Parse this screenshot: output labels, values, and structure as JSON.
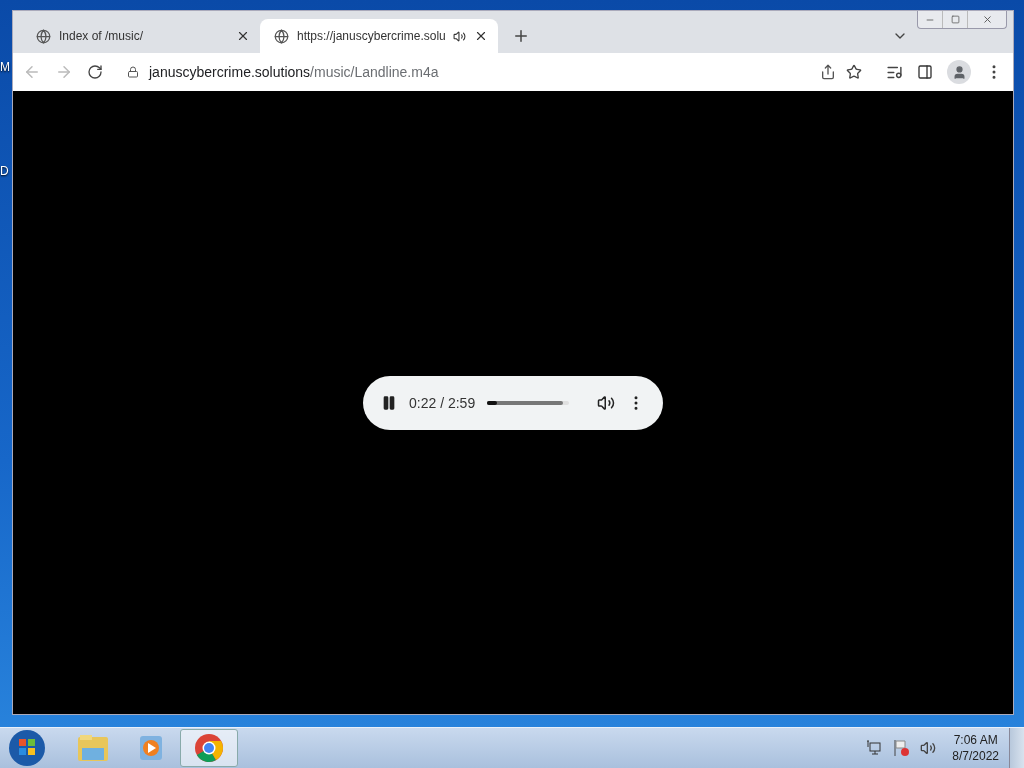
{
  "desktop": {
    "icon_labels": [
      "M",
      "D"
    ]
  },
  "browser": {
    "tabs": [
      {
        "title": "Index of /music/",
        "selected": false,
        "audio": false
      },
      {
        "title": "https://januscybercrime.solu",
        "selected": true,
        "audio": true
      }
    ],
    "address": {
      "host": "januscybercrime.solutions",
      "path": "/music/Landline.m4a"
    },
    "player": {
      "playing": true,
      "time": "0:22 / 2:59",
      "level": 0.12
    }
  },
  "taskbar": {
    "apps": [
      {
        "kind": "explorer",
        "selected": false
      },
      {
        "kind": "media",
        "selected": false
      },
      {
        "kind": "chrome",
        "selected": true
      }
    ],
    "clock": {
      "time": "7:06 AM",
      "date": "8/7/2022"
    }
  }
}
